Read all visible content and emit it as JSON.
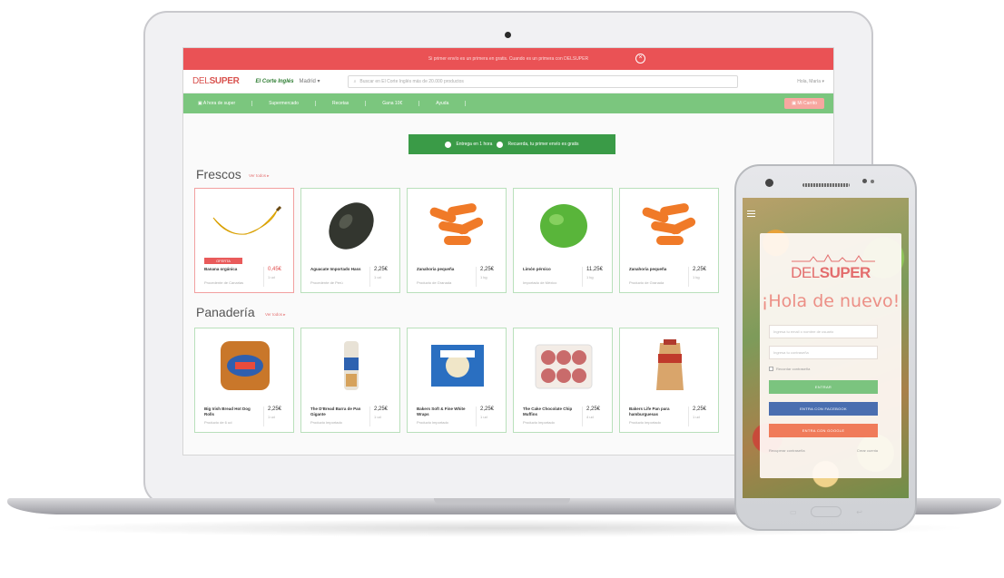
{
  "promo_text": "Si primer envío es un primera en gratis. Cuando es un primera con DELSUPER",
  "header": {
    "logo_del": "DEL",
    "logo_super": "SUPER",
    "store": "El Corte Inglés",
    "city": "Madrid",
    "search_placeholder": "Buscar en El Corte Inglés más de 20.000 productos",
    "user": "Hola, María"
  },
  "nav": {
    "items": [
      "A hora de super",
      "Supermercado",
      "Recetas",
      "Gana 10€",
      "Ayuda"
    ],
    "cart": "Mi Carrito"
  },
  "banner": {
    "delivery": "Entrega en 1 hora",
    "free_shipping": "Recuerda, tu primer envío es gratis"
  },
  "sections": [
    {
      "title": "Frescos",
      "see_all": "Ver todos",
      "products": [
        {
          "name": "Banana orgánica",
          "sub": "Procedente de Canarias",
          "price": "0,45€",
          "unit": "1 ud",
          "offer": "OFERTA",
          "img": "banana"
        },
        {
          "name": "Aguacate Importado Hass",
          "sub": "Procedente de Perú",
          "price": "2,25€",
          "unit": "1 ud",
          "img": "avocado"
        },
        {
          "name": "Zanahoria pequeña",
          "sub": "Producto de Granada",
          "price": "2,25€",
          "unit": "1 kg",
          "img": "carrots"
        },
        {
          "name": "Limón pérsico",
          "sub": "Importado de México",
          "price": "11,25€",
          "unit": "1 kg",
          "img": "lime"
        },
        {
          "name": "Zanahoria pequeña",
          "sub": "Producto de Granada",
          "price": "2,25€",
          "unit": "1 kg",
          "img": "carrots"
        }
      ]
    },
    {
      "title": "Panadería",
      "see_all": "Ver todos",
      "products": [
        {
          "name": "Big Irish Bread Hot Dog Rolls",
          "sub": "Producto de 6 ud",
          "price": "2,25€",
          "unit": "1 ud",
          "img": "bread-bag"
        },
        {
          "name": "The D'Bread Barra de Pan Gigante",
          "sub": "Producto importado",
          "price": "2,25€",
          "unit": "1 ud",
          "img": "bread-loaf"
        },
        {
          "name": "Bakers Soft & Fine White Wraps",
          "sub": "Producto importado",
          "price": "2,25€",
          "unit": "1 ud",
          "img": "wraps"
        },
        {
          "name": "The Cake Chocolate Chip Muffins",
          "sub": "Producto importado",
          "price": "2,25€",
          "unit": "4 ud",
          "img": "muffins"
        },
        {
          "name": "Bakers Life Pan para hamburguesas",
          "sub": "Producto importado",
          "price": "2,25€",
          "unit": "1 ud",
          "img": "buns"
        }
      ]
    }
  ],
  "phone": {
    "logo_del": "DEL",
    "logo_super": "SUPER",
    "greeting": "¡Hola de nuevo!",
    "email_placeholder": "Ingresa tu email o nombre de usuario",
    "password_placeholder": "Ingresa tu contraseña",
    "remember": "Recordar contraseña",
    "login_button": "ENTRAR",
    "facebook_button": "ENTRA CON FACEBOOK",
    "google_button": "ENTRA CON GOOGLE",
    "forgot": "Recuperar contraseña",
    "signup": "Crear cuenta"
  },
  "colors": {
    "promo": "#ea5255",
    "nav": "#7bc67e",
    "banner": "#3a9b47",
    "facebook": "#4a6eb0",
    "google": "#f07b5a",
    "login": "#7bc47f"
  }
}
